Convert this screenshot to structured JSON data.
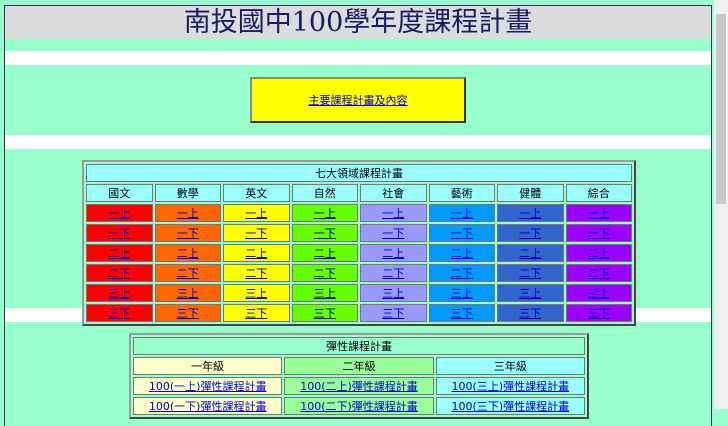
{
  "title": "南投國中100學年度課程計畫",
  "main_link": "主要課程計畫及內容",
  "domains": {
    "caption": "七大領域課程計畫",
    "columns": [
      {
        "name": "國文",
        "color": "#ff0000"
      },
      {
        "name": "數學",
        "color": "#ff6600"
      },
      {
        "name": "英文",
        "color": "#ffff00"
      },
      {
        "name": "自然",
        "color": "#66ff00"
      },
      {
        "name": "社會",
        "color": "#9999ff"
      },
      {
        "name": "藝術",
        "color": "#0099ff"
      },
      {
        "name": "健體",
        "color": "#3366cc"
      },
      {
        "name": "綜合",
        "color": "#9900ff"
      }
    ],
    "rows": [
      "一上",
      "一下",
      "二上",
      "二下",
      "三上",
      "三下"
    ]
  },
  "flex": {
    "caption": "彈性課程計畫",
    "grades": [
      {
        "name": "一年級",
        "color": "#ffffcc",
        "links": [
          "100(一上)彈性課程計畫",
          "100(一下)彈性課程計畫"
        ]
      },
      {
        "name": "二年級",
        "color": "#99ff99",
        "links": [
          "100(二上)彈性課程計畫",
          "100(二下)彈性課程計畫"
        ]
      },
      {
        "name": "三年級",
        "color": "#99ffff",
        "links": [
          "100(三上)彈性課程計畫",
          "100(三下)彈性課程計畫"
        ]
      }
    ]
  }
}
